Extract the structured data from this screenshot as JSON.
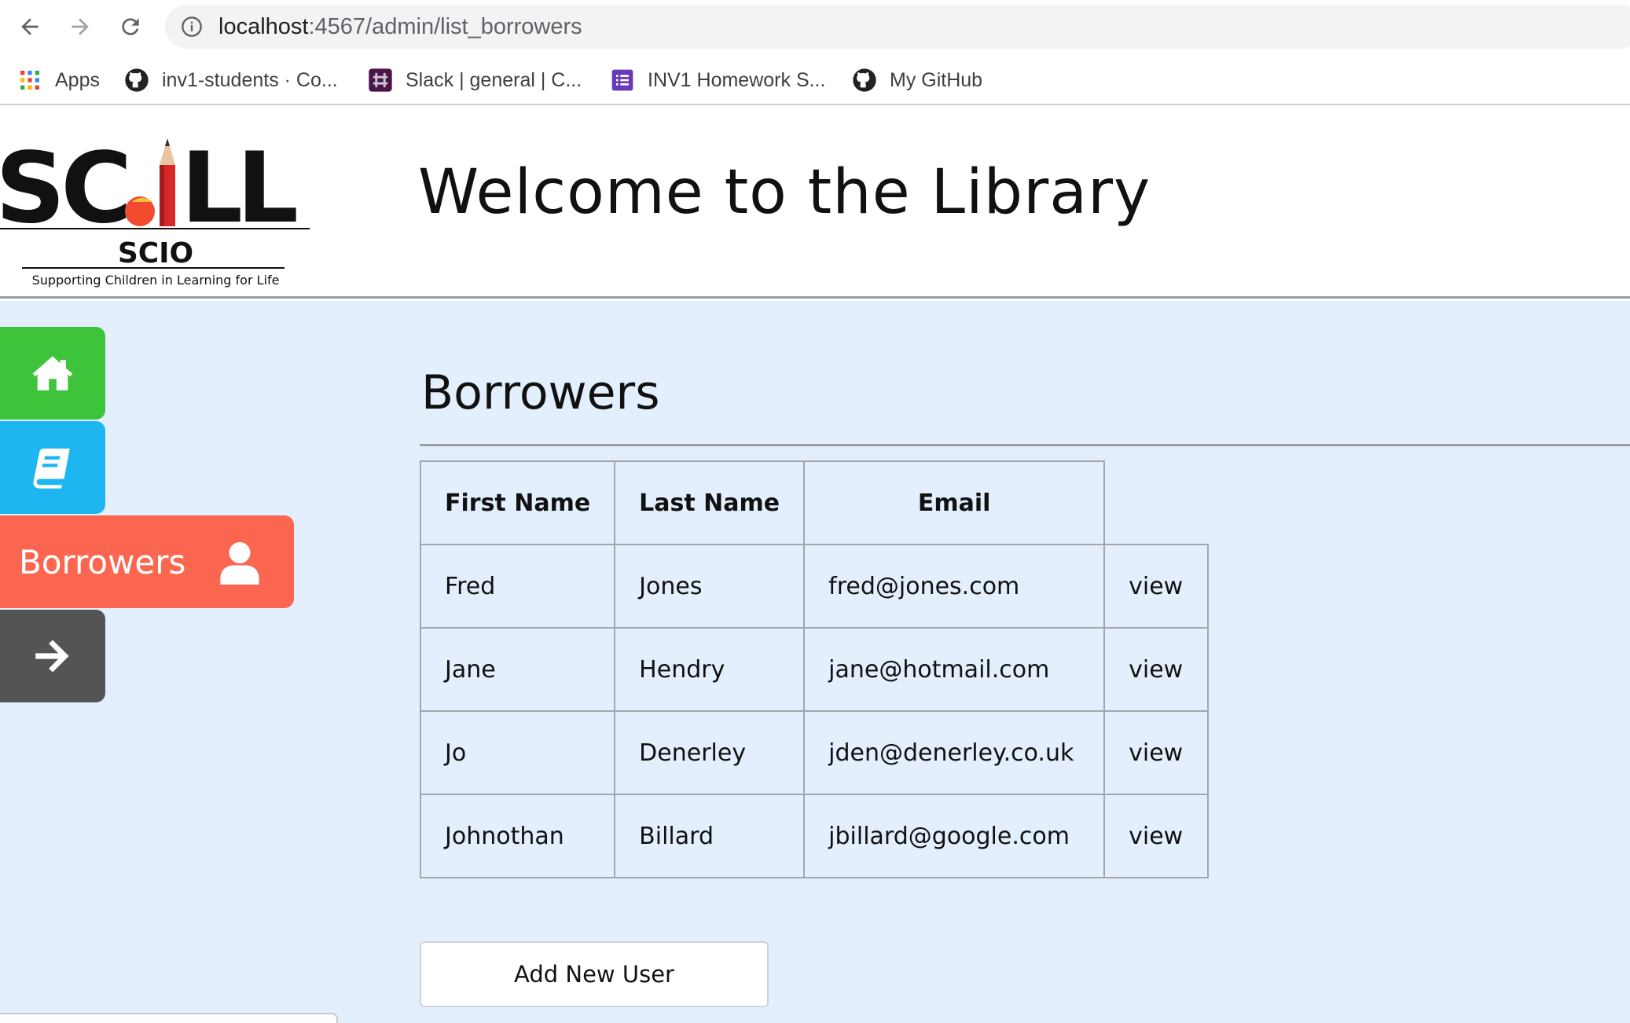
{
  "browser": {
    "url_host": "localhost",
    "url_path": ":4567/admin/list_borrowers",
    "bookmarks": [
      {
        "label": "Apps",
        "icon": "apps-grid-icon"
      },
      {
        "label": "inv1-students · Co...",
        "icon": "github-icon"
      },
      {
        "label": "Slack | general | C...",
        "icon": "slack-icon"
      },
      {
        "label": "INV1 Homework S...",
        "icon": "forms-icon"
      },
      {
        "label": "My GitHub",
        "icon": "github-icon"
      }
    ]
  },
  "header": {
    "logo_text": "SCILL",
    "logo_sub": "SCIO",
    "logo_tagline": "Supporting Children in Learning for Life",
    "title": "Welcome to the Library"
  },
  "sidebar": {
    "items": [
      {
        "name": "home",
        "icon": "home-icon",
        "color": "#3ec43a"
      },
      {
        "name": "books",
        "icon": "book-icon",
        "color": "#1eb6f0"
      },
      {
        "name": "borrowers",
        "label": "Borrowers",
        "icon": "user-icon",
        "color": "#fa6650"
      },
      {
        "name": "logout",
        "icon": "arrow-right-icon",
        "color": "#545454"
      }
    ]
  },
  "main": {
    "title": "Borrowers",
    "table": {
      "headers": [
        "First Name",
        "Last Name",
        "Email"
      ],
      "rows": [
        {
          "first": "Fred",
          "last": "Jones",
          "email": "fred@jones.com",
          "action": "view"
        },
        {
          "first": "Jane",
          "last": "Hendry",
          "email": "jane@hotmail.com",
          "action": "view"
        },
        {
          "first": "Jo",
          "last": "Denerley",
          "email": "jden@denerley.co.uk",
          "action": "view"
        },
        {
          "first": "Johnothan",
          "last": "Billard",
          "email": "jbillard@google.com",
          "action": "view"
        }
      ]
    },
    "add_button_label": "Add New User"
  },
  "colors": {
    "main_bg": "#e3effc",
    "home": "#3ec43a",
    "books": "#1eb6f0",
    "borrowers": "#fa6650",
    "logout": "#545454"
  }
}
